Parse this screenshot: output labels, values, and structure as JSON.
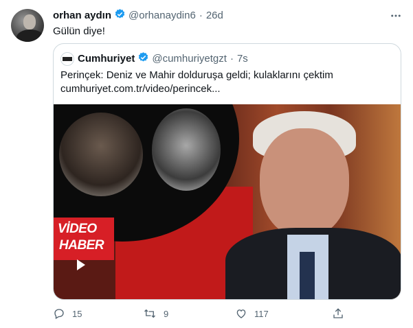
{
  "tweet": {
    "author_name": "orhan aydın",
    "author_handle": "@orhanaydin6",
    "separator": "·",
    "time": "26d",
    "text": "Gülün diye!",
    "more_icon": "more-icon"
  },
  "quote": {
    "author_name": "Cumhuriyet",
    "author_handle": "@cumhuriyetgzt",
    "separator": "·",
    "time": "7s",
    "text_line1": "Perinçek: Deniz ve Mahir dolduruşa geldi; kulaklarını çektim",
    "text_line2": "cumhuriyet.com.tr/video/perincek...",
    "badge_line1": "VİDEO",
    "badge_line2": "HABER"
  },
  "actions": {
    "reply_count": "15",
    "retweet_count": "9",
    "like_count": "117",
    "share_icon": "share-icon"
  },
  "colors": {
    "verified": "#1d9bf0",
    "muted": "#536471",
    "badge": "#d71f26"
  }
}
